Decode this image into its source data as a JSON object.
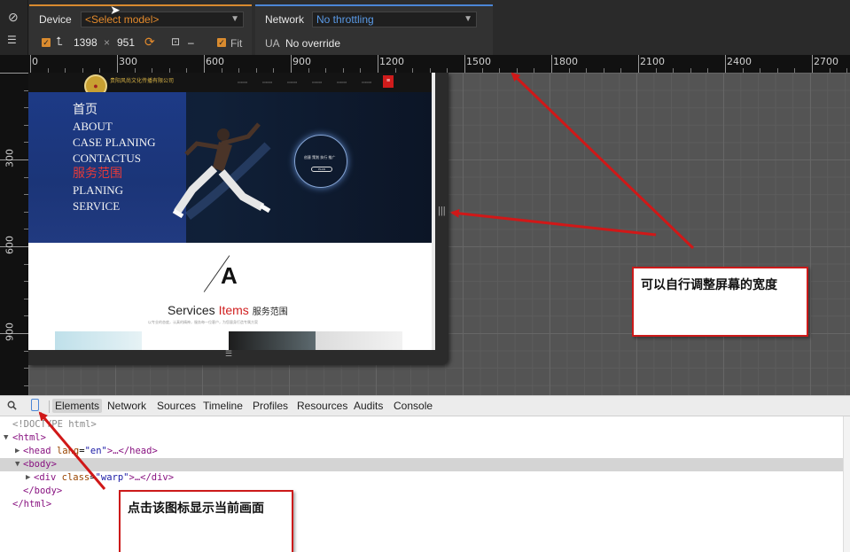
{
  "emulation": {
    "device_label": "Device",
    "device_model": "<Select model>",
    "width": "1398",
    "times": "×",
    "height": "951",
    "dash": "–",
    "fit_label": "Fit",
    "network_label": "Network",
    "network_value": "No throttling",
    "ua_label": "UA",
    "ua_value": "No override"
  },
  "ruler": {
    "h_labels": [
      "0",
      "300",
      "600",
      "900",
      "1200",
      "1500",
      "1800",
      "2100",
      "2400",
      "2700"
    ],
    "v_labels": [
      "300",
      "600",
      "900"
    ]
  },
  "site": {
    "company_name": "贵阳风尚文化传播有限公司",
    "menu": [
      "首页",
      "ABOUT",
      "CASE PLANING",
      "CONTACTUS",
      "服务范围",
      "PLANING",
      "SERVICE"
    ],
    "circle_text": "创意  策划  执行  推广",
    "circle_button": "PLAN",
    "big_letter": "A",
    "services_word": "Services",
    "items_word": "Items",
    "services_cn": "服务范围",
    "services_sub": "以专业的态度，认真的精神，服务每一位客户，为您量身打造专属方案"
  },
  "devtools": {
    "tabs": [
      "Elements",
      "Network",
      "Sources",
      "Timeline",
      "Profiles",
      "Resources",
      "Audits",
      "Console"
    ],
    "dom": {
      "doctype": "<!DOCTYPE html>",
      "html_open": "<html>",
      "head_tag": "head",
      "head_attr": "lang",
      "head_val": "\"en\"",
      "head_rest": ">…</head>",
      "body_open": "<body>",
      "div_tag": "div",
      "div_attr": "class",
      "div_val": "\"warp\"",
      "div_rest": ">…</div>",
      "body_close": "</body>",
      "html_close": "</html>"
    }
  },
  "annotations": {
    "resize_note": "可以自行调整屏幕的宽度",
    "icon_note": "点击该图标显示当前画面"
  },
  "colors": {
    "accent_orange": "#e38a2c",
    "accent_blue": "#5a9ae6",
    "annotation_red": "#cc1a1a"
  }
}
